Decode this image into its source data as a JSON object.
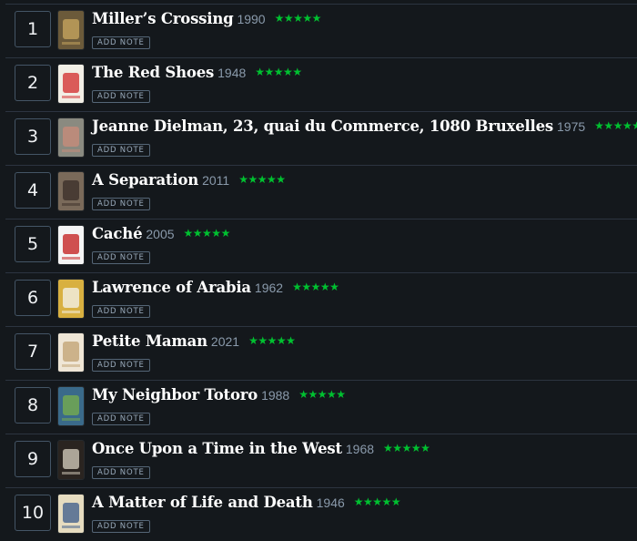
{
  "films": [
    {
      "rank": "1",
      "title": "Miller’s Crossing",
      "year": "1990",
      "stars": "★★★★★",
      "note": "ADD NOTE",
      "poster": {
        "bg": "#6b5a3a",
        "fg": "#c9a860"
      }
    },
    {
      "rank": "2",
      "title": "The Red Shoes",
      "year": "1948",
      "stars": "★★★★★",
      "note": "ADD NOTE",
      "poster": {
        "bg": "#f2efe6",
        "fg": "#d22a2a"
      }
    },
    {
      "rank": "3",
      "title": "Jeanne Dielman, 23, quai du Commerce, 1080 Bruxelles",
      "year": "1975",
      "stars": "★★★★★",
      "note": "ADD NOTE",
      "poster": {
        "bg": "#8a8a80",
        "fg": "#c98b7a"
      }
    },
    {
      "rank": "4",
      "title": "A Separation",
      "year": "2011",
      "stars": "★★★★★",
      "note": "ADD NOTE",
      "poster": {
        "bg": "#7a6a5a",
        "fg": "#3a2e28"
      }
    },
    {
      "rank": "5",
      "title": "Caché",
      "year": "2005",
      "stars": "★★★★★",
      "note": "ADD NOTE",
      "poster": {
        "bg": "#f5f5f5",
        "fg": "#c21818"
      }
    },
    {
      "rank": "6",
      "title": "Lawrence of Arabia",
      "year": "1962",
      "stars": "★★★★★",
      "note": "ADD NOTE",
      "poster": {
        "bg": "#d8b040",
        "fg": "#f4f4f0"
      }
    },
    {
      "rank": "7",
      "title": "Petite Maman",
      "year": "2021",
      "stars": "★★★★★",
      "note": "ADD NOTE",
      "poster": {
        "bg": "#efe6d6",
        "fg": "#c0a070"
      }
    },
    {
      "rank": "8",
      "title": "My Neighbor Totoro",
      "year": "1988",
      "stars": "★★★★★",
      "note": "ADD NOTE",
      "poster": {
        "bg": "#3a6a8a",
        "fg": "#7ab04a"
      }
    },
    {
      "rank": "9",
      "title": "Once Upon a Time in the West",
      "year": "1968",
      "stars": "★★★★★",
      "note": "ADD NOTE",
      "poster": {
        "bg": "#2a2420",
        "fg": "#d8d0c0"
      }
    },
    {
      "rank": "10",
      "title": "A Matter of Life and Death",
      "year": "1946",
      "stars": "★★★★★",
      "note": "ADD NOTE",
      "poster": {
        "bg": "#e6dcc0",
        "fg": "#3a5a8a"
      }
    }
  ],
  "colors": {
    "background": "#14181c",
    "divider": "#2c3440",
    "star_green": "#00c030",
    "title": "#ffffff",
    "year": "#8a9aab"
  }
}
